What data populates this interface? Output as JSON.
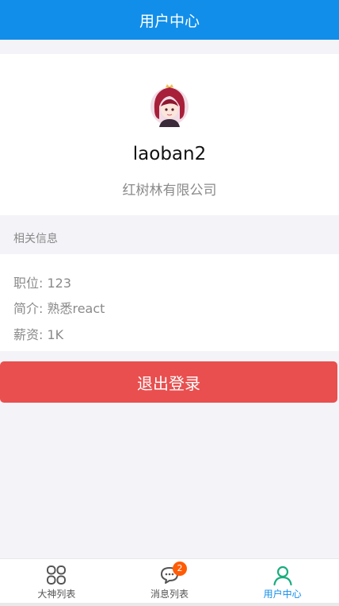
{
  "navbar": {
    "title": "用户中心"
  },
  "profile": {
    "username": "laoban2",
    "company": "红树林有限公司"
  },
  "info": {
    "section_title": "相关信息",
    "position": "职位: 123",
    "intro": "简介: 熟悉react",
    "salary": "薪资: 1K"
  },
  "actions": {
    "logout_label": "退出登录"
  },
  "tabbar": {
    "tabs": [
      {
        "label": "大神列表",
        "icon": "grid-icon"
      },
      {
        "label": "消息列表",
        "icon": "chat-icon",
        "badge": "2"
      },
      {
        "label": "用户中心",
        "icon": "user-icon",
        "active": true
      }
    ]
  },
  "colors": {
    "primary": "#118ee9",
    "danger": "#e94f4f",
    "badge": "#ff5b05",
    "active_icon": "#1aad7e",
    "background": "#f4f3f8"
  }
}
